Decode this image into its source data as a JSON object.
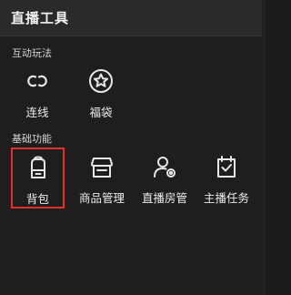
{
  "panel": {
    "title": "直播工具"
  },
  "sections": [
    {
      "title": "互动玩法",
      "items": [
        {
          "label": "连线",
          "icon": "link-icon"
        },
        {
          "label": "福袋",
          "icon": "star-badge-icon"
        }
      ]
    },
    {
      "title": "基础功能",
      "items": [
        {
          "label": "背包",
          "icon": "backpack-icon",
          "selected": true
        },
        {
          "label": "商品管理",
          "icon": "store-icon"
        },
        {
          "label": "直播房管",
          "icon": "user-settings-icon"
        },
        {
          "label": "主播任务",
          "icon": "task-check-icon"
        }
      ]
    }
  ],
  "colors": {
    "background": "#1e1e1e",
    "header": "#2a2a2a",
    "selection": "#e0312e",
    "text": "#ececec"
  }
}
